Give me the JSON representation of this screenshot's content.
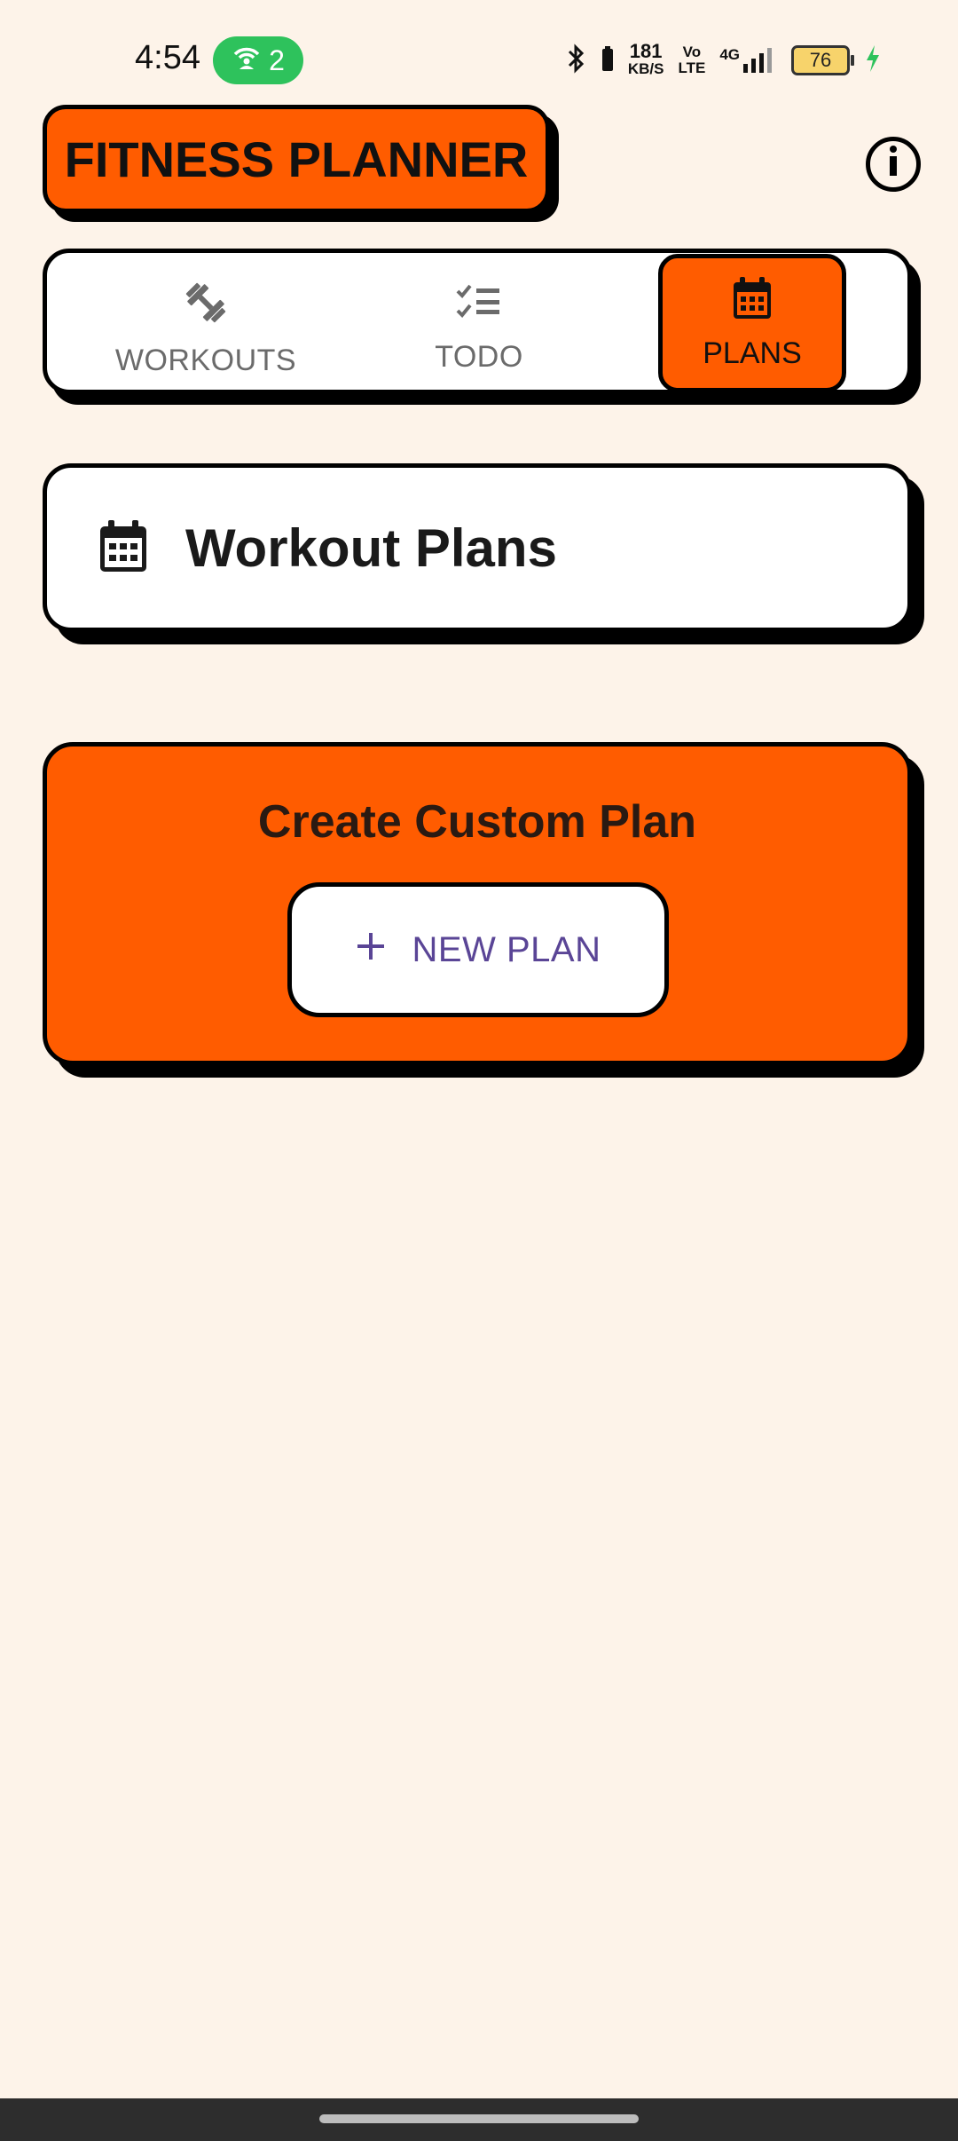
{
  "status_bar": {
    "time": "4:54",
    "hotspot_count": "2",
    "net_speed_value": "181",
    "net_speed_unit": "KB/S",
    "volte_top": "Vo",
    "volte_bottom": "LTE",
    "network": "4G",
    "battery_level": "76"
  },
  "header": {
    "app_title": "FITNESS PLANNER",
    "info_icon": "info-icon"
  },
  "tabs": [
    {
      "label": "WORKOUTS",
      "icon": "dumbbell-icon",
      "active": false
    },
    {
      "label": "TODO",
      "icon": "checklist-icon",
      "active": false
    },
    {
      "label": "PLANS",
      "icon": "calendar-icon",
      "active": true
    }
  ],
  "plans_header": {
    "title": "Workout Plans",
    "icon": "calendar-icon"
  },
  "create_plan": {
    "title": "Create Custom Plan",
    "button_label": "NEW PLAN",
    "button_icon": "plus-icon"
  },
  "colors": {
    "background": "#fdf3e9",
    "accent": "#ff5c00",
    "button_text": "#5a4596",
    "hotspot": "#2ec25c"
  }
}
